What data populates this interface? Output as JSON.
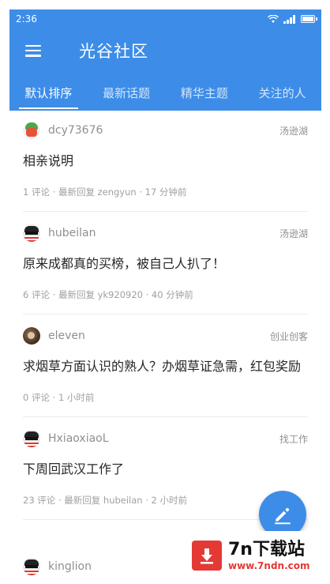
{
  "statusbar": {
    "time": "2:36"
  },
  "appbar": {
    "title": "光谷社区"
  },
  "tabs": [
    {
      "label": "默认排序"
    },
    {
      "label": "最新话题"
    },
    {
      "label": "精华主题"
    },
    {
      "label": "关注的人"
    }
  ],
  "topics": [
    {
      "username": "dcy73676",
      "node": "汤逊湖",
      "title": "相亲说明",
      "meta": "1 评论 · 最新回复 zengyun · 17 分钟前"
    },
    {
      "username": "hubeilan",
      "node": "汤逊湖",
      "title": "原来成都真的买榜，被自己人扒了！",
      "meta": "6 评论 · 最新回复 yk920920 · 40 分钟前"
    },
    {
      "username": "eleven",
      "node": "创业创客",
      "title": "求烟草方面认识的熟人？办烟草证急需，红包奖励",
      "meta": "0 评论 · 1 小时前"
    },
    {
      "username": "HxiaoxiaoL",
      "node": "找工作",
      "title": "下周回武汉工作了",
      "meta": "23 评论 · 最新回复 hubeilan · 2 小时前"
    },
    {
      "username": "kinglion"
    }
  ],
  "watermark": {
    "title": "7n下载站",
    "url": "www.7ndn.com"
  },
  "colors": {
    "primary": "#3d8de8",
    "watermark_red": "#e53935"
  },
  "icons": [
    "menu-icon",
    "wifi-icon",
    "signal-icon",
    "battery-icon",
    "edit-icon",
    "download-icon"
  ]
}
